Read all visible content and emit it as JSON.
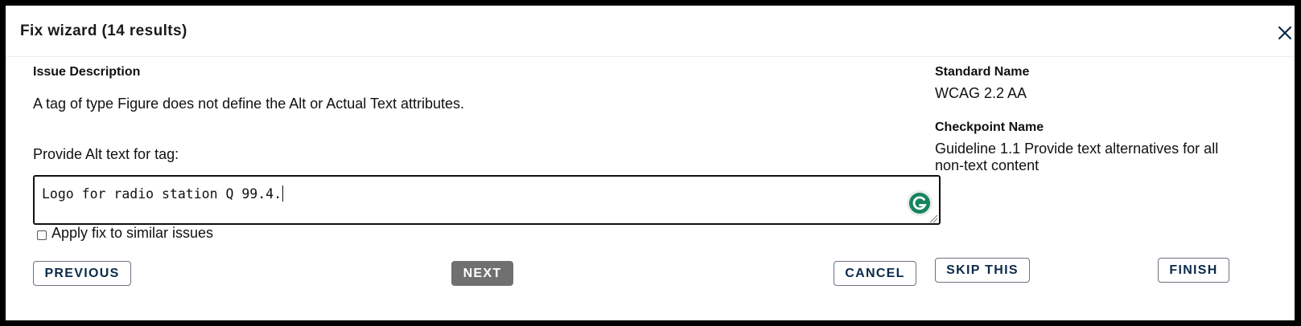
{
  "dialog": {
    "title": "Fix wizard (14 results)",
    "close_icon": "close-icon"
  },
  "issue": {
    "heading": "Issue Description",
    "description": "A tag of type Figure does not define the Alt or Actual Text attributes."
  },
  "alt_text": {
    "label": "Provide Alt text for tag:",
    "value": "Logo for radio station Q 99.4.",
    "grammarly_icon": "grammarly-icon"
  },
  "apply_similar": {
    "label": "Apply fix to similar issues",
    "checked": false
  },
  "buttons": {
    "previous": "PREVIOUS",
    "next": "NEXT",
    "cancel": "CANCEL",
    "skip": "SKIP THIS",
    "finish": "FINISH"
  },
  "standard": {
    "heading": "Standard Name",
    "value": "WCAG 2.2 AA"
  },
  "checkpoint": {
    "heading": "Checkpoint Name",
    "value": "Guideline 1.1 Provide text alternatives for all non-text content"
  },
  "colors": {
    "primary_button": "#707070",
    "button_text": "#0b2a4a",
    "grammarly": "#15845f"
  }
}
